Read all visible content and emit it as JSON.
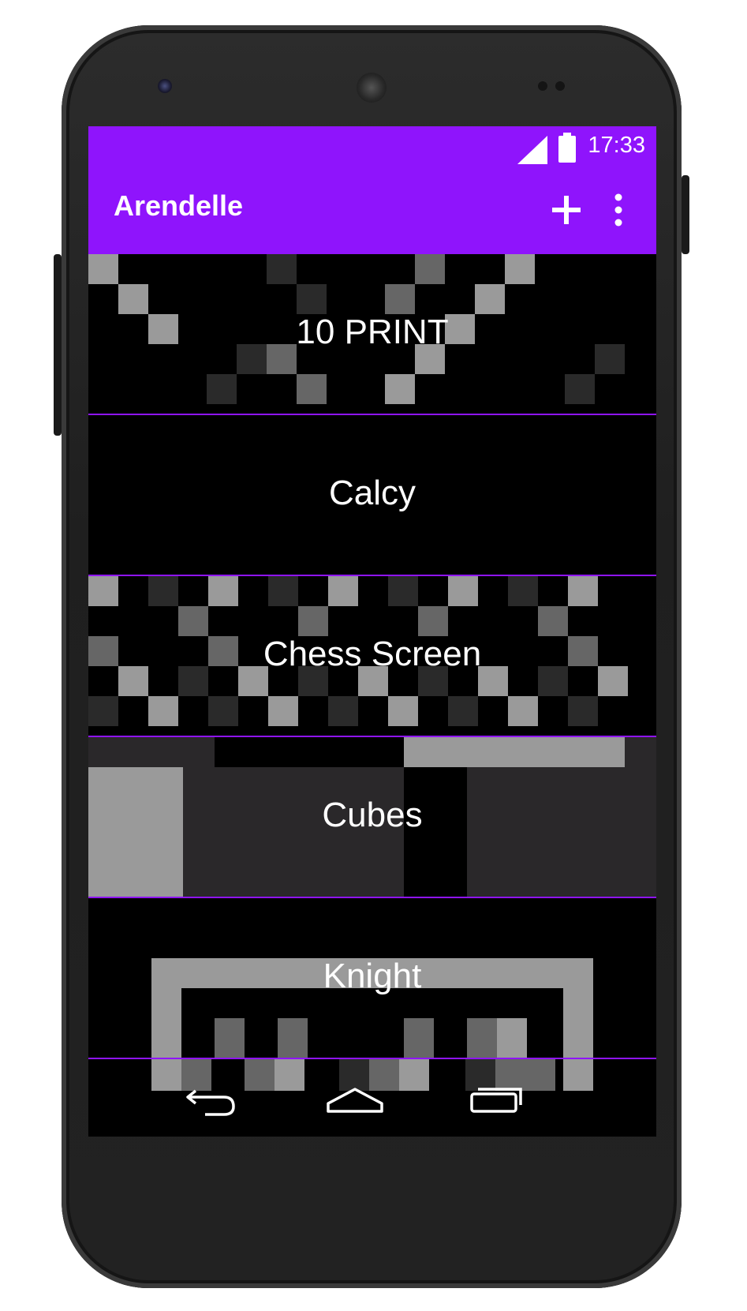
{
  "status_bar": {
    "time": "17:33",
    "signal_icon": "signal-icon",
    "battery_icon": "battery-icon"
  },
  "app_bar": {
    "title": "Arendelle",
    "add_icon": "plus-icon",
    "more_icon": "overflow-menu-icon"
  },
  "colors": {
    "accent": "#8f14fc",
    "background": "#000000",
    "text": "#ffffff"
  },
  "projects": [
    {
      "name": "10 PRINT"
    },
    {
      "name": "Calcy"
    },
    {
      "name": "Chess Screen"
    },
    {
      "name": "Cubes"
    },
    {
      "name": "Knight"
    }
  ],
  "nav_bar": {
    "back_icon": "back-icon",
    "home_icon": "home-icon",
    "recents_icon": "recents-icon"
  }
}
